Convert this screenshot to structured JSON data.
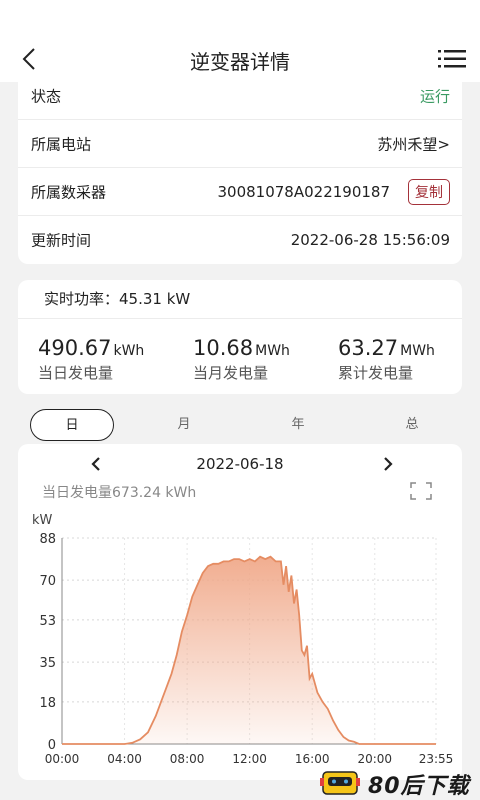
{
  "header": {
    "title": "逆变器详情"
  },
  "info": {
    "status_label": "状态",
    "status_value": "运行",
    "station_label": "所属电站",
    "station_value": "苏州禾望>",
    "collector_label": "所属数采器",
    "collector_value": "30081078A022190187",
    "copy_label": "复制",
    "updated_label": "更新时间",
    "updated_value": "2022-06-28 15:56:09"
  },
  "power": {
    "realtime": "实时功率：45.31 kW",
    "stats": [
      {
        "num": "490.67",
        "unit": "kWh",
        "name": "当日发电量"
      },
      {
        "num": "10.68",
        "unit": "MWh",
        "name": "当月发电量"
      },
      {
        "num": "63.27",
        "unit": "MWh",
        "name": "累计发电量"
      }
    ]
  },
  "tabs": [
    "日",
    "月",
    "年",
    "总"
  ],
  "date": "2022-06-18",
  "daily_total": "当日发电量673.24 kWh",
  "colors": {
    "accent": "#e58c62",
    "fill_top": "#f0a98a",
    "green": "#3a9a62",
    "copy": "#a4323a"
  },
  "chart_data": {
    "type": "area",
    "ylabel": "kW",
    "ylim": [
      0,
      88
    ],
    "yticks": [
      0,
      18,
      35,
      53,
      70,
      88
    ],
    "xticks": [
      "00:00",
      "04:00",
      "08:00",
      "12:00",
      "16:00",
      "20:00",
      "23:55"
    ],
    "x": [
      "00:00",
      "04:00",
      "04:30",
      "05:00",
      "05:30",
      "06:00",
      "06:20",
      "06:40",
      "07:00",
      "07:20",
      "07:40",
      "08:00",
      "08:20",
      "08:40",
      "09:00",
      "09:20",
      "09:40",
      "10:00",
      "10:20",
      "10:40",
      "11:00",
      "11:20",
      "11:40",
      "12:00",
      "12:20",
      "12:40",
      "13:00",
      "13:20",
      "13:40",
      "14:00",
      "14:10",
      "14:20",
      "14:30",
      "14:40",
      "14:50",
      "15:00",
      "15:10",
      "15:20",
      "15:30",
      "15:40",
      "15:50",
      "16:00",
      "16:20",
      "16:40",
      "17:00",
      "17:20",
      "17:40",
      "18:00",
      "18:20",
      "18:40",
      "19:00",
      "20:00",
      "23:55"
    ],
    "values": [
      0,
      0,
      0.5,
      2,
      5,
      12,
      18,
      24,
      30,
      38,
      48,
      55,
      63,
      68,
      73,
      76,
      77,
      77,
      78,
      78,
      79,
      79,
      78,
      79,
      78,
      80,
      79,
      80,
      78,
      78,
      68,
      76,
      65,
      72,
      60,
      66,
      55,
      40,
      38,
      42,
      28,
      30,
      22,
      18,
      15,
      10,
      6,
      3,
      1.5,
      1,
      0,
      0,
      0
    ]
  },
  "watermark": {
    "text": "80后下载"
  }
}
